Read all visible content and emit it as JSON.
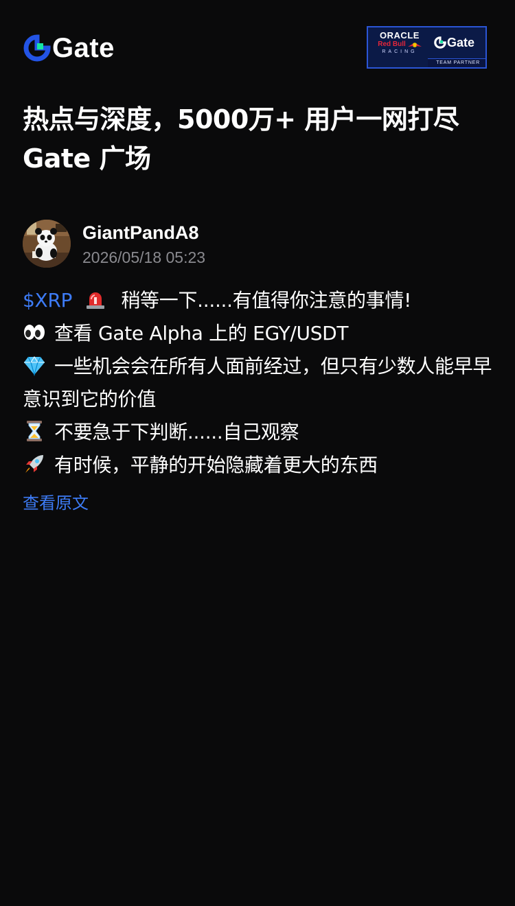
{
  "header": {
    "brand_name": "Gate",
    "partner_badge": {
      "oracle": "ORACLE",
      "redbull": "Red Bull",
      "racing": "RACING",
      "gate": "Gate",
      "team_partner": "TEAM PARTNER"
    }
  },
  "headline": {
    "line1": "热点与深度，5000万+ 用户一网打尽",
    "line2": "Gate 广场"
  },
  "author": {
    "name": "GiantPandA8",
    "timestamp": "2026/05/18 05:23",
    "avatar_icon": "panda-avatar"
  },
  "post": {
    "ticker": "$XRP",
    "line1_text": "稍等一下......有值得你注意的事情!",
    "line2_text": "查看 Gate Alpha 上的 EGY/USDT",
    "line3_text": "一些机会会在所有人面前经过，但只有少数人能早早意识到它的价值",
    "line4_text": "不要急于下判断......自己观察",
    "line5_text": "有时候，平静的开始隐藏着更大的东西",
    "icons": [
      "siren-icon",
      "eyes-icon",
      "gem-icon",
      "hourglass-icon",
      "rocket-icon"
    ]
  },
  "view_original": "查看原文",
  "colors": {
    "background": "#0a0a0b",
    "link": "#3d7bf5",
    "muted": "#8a8a8f",
    "brand_accent": "#2354e6",
    "brand_green": "#17e6a1"
  }
}
